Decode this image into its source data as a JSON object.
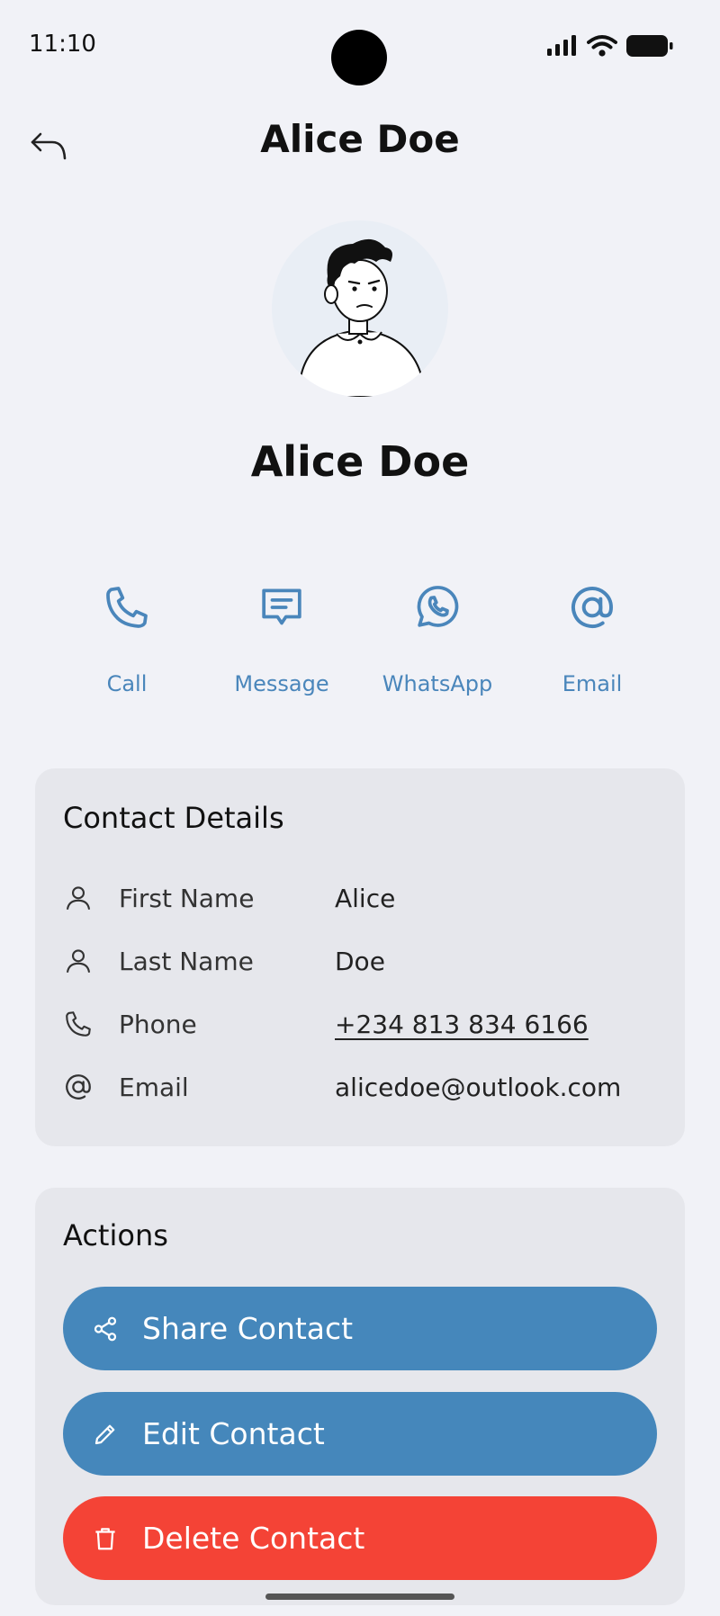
{
  "status": {
    "time": "11:10"
  },
  "header": {
    "title": "Alice Doe"
  },
  "profile": {
    "name": "Alice Doe"
  },
  "quick_actions": [
    {
      "label": "Call",
      "icon": "phone-icon"
    },
    {
      "label": "Message",
      "icon": "message-icon"
    },
    {
      "label": "WhatsApp",
      "icon": "whatsapp-icon"
    },
    {
      "label": "Email",
      "icon": "at-icon"
    }
  ],
  "details": {
    "title": "Contact Details",
    "rows": [
      {
        "label": "First Name",
        "value": "Alice",
        "icon": "person-icon"
      },
      {
        "label": "Last Name",
        "value": "Doe",
        "icon": "person-icon"
      },
      {
        "label": "Phone",
        "value": "+234 813 834 6166",
        "icon": "phone-icon"
      },
      {
        "label": "Email",
        "value": "alicedoe@outlook.com",
        "icon": "at-icon"
      }
    ]
  },
  "actions": {
    "title": "Actions",
    "buttons": [
      {
        "label": "Share Contact",
        "icon": "share-icon",
        "color": "#4587bb"
      },
      {
        "label": "Edit Contact",
        "icon": "pencil-icon",
        "color": "#4587bb"
      },
      {
        "label": "Delete Contact",
        "icon": "trash-icon",
        "color": "#f44336"
      }
    ]
  },
  "colors": {
    "accent": "#4a86bb",
    "background": "#f1f2f7",
    "card": "#e6e7ec",
    "danger": "#f44336"
  }
}
